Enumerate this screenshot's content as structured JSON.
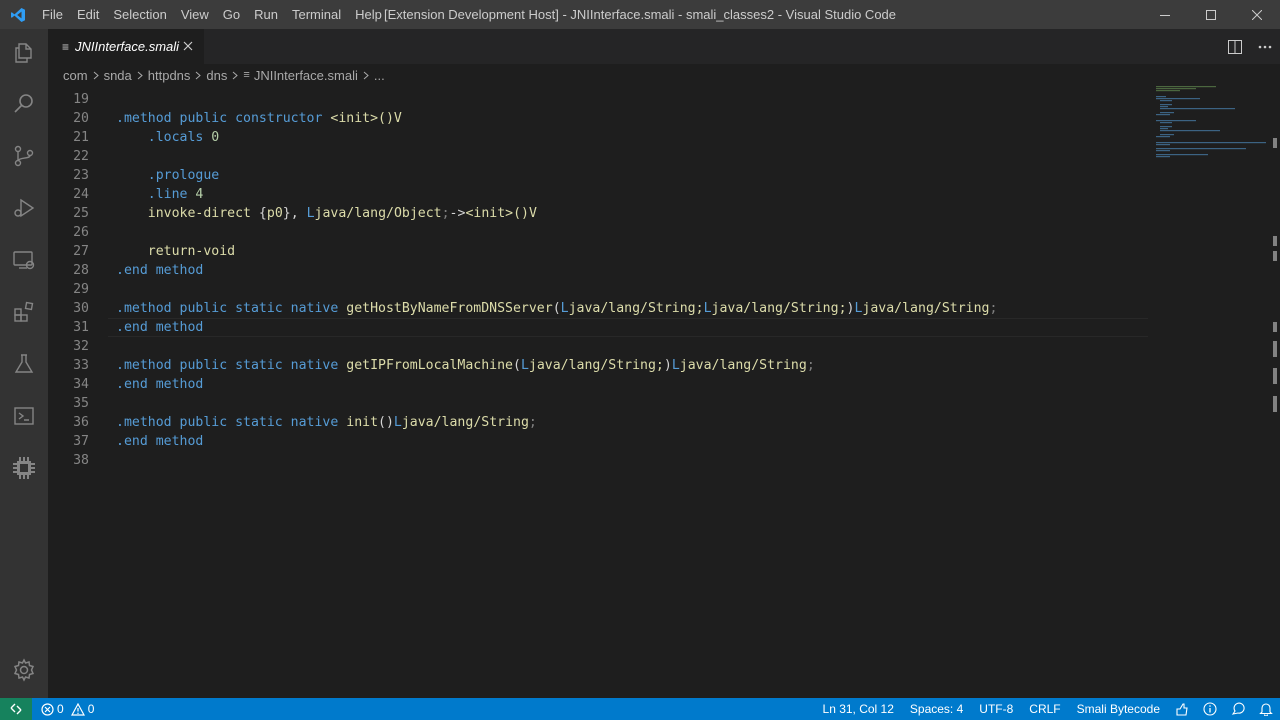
{
  "window": {
    "title": "[Extension Development Host] - JNIInterface.smali - smali_classes2 - Visual Studio Code",
    "menu": [
      "File",
      "Edit",
      "Selection",
      "View",
      "Go",
      "Run",
      "Terminal",
      "Help"
    ]
  },
  "activity_bar": {
    "items": [
      "explorer-icon",
      "search-icon",
      "source-control-icon",
      "run-debug-icon",
      "remote-explorer-icon",
      "extensions-icon",
      "testing-icon",
      "terminal-icon",
      "chip-icon"
    ],
    "bottom": "settings-gear-icon"
  },
  "tab": {
    "label": "JNIInterface.smali",
    "icon_glyph": "≡"
  },
  "breadcrumb": {
    "items": [
      "com",
      "snda",
      "httpdns",
      "dns",
      "JNIInterface.smali",
      "..."
    ]
  },
  "editor": {
    "current_line": 31,
    "lines": [
      {
        "n": "19",
        "tokens": []
      },
      {
        "n": "20",
        "tokens": [
          {
            "t": ".method",
            "c": "kw"
          },
          {
            "t": " public constructor ",
            "c": "pub"
          },
          {
            "t": "<init>",
            "c": "fn"
          },
          {
            "t": "()V",
            "c": "fn"
          }
        ]
      },
      {
        "n": "21",
        "tokens": [
          {
            "t": "    .locals ",
            "c": "kw"
          },
          {
            "t": "0",
            "c": "num"
          }
        ]
      },
      {
        "n": "22",
        "tokens": []
      },
      {
        "n": "23",
        "tokens": [
          {
            "t": "    .prologue",
            "c": "kw"
          }
        ]
      },
      {
        "n": "24",
        "tokens": [
          {
            "t": "    .line ",
            "c": "kw"
          },
          {
            "t": "4",
            "c": "num"
          }
        ]
      },
      {
        "n": "25",
        "tokens": [
          {
            "t": "    invoke-direct ",
            "c": "fn"
          },
          {
            "t": "{",
            "c": "punc"
          },
          {
            "t": "p0",
            "c": "fn"
          },
          {
            "t": "}, ",
            "c": "punc"
          },
          {
            "t": "L",
            "c": "kw"
          },
          {
            "t": "java/lang/Object",
            "c": "fn"
          },
          {
            "t": ";",
            "c": "dim"
          },
          {
            "t": "->",
            "c": "punc"
          },
          {
            "t": "<init>",
            "c": "fn"
          },
          {
            "t": "()V",
            "c": "fn"
          }
        ]
      },
      {
        "n": "26",
        "tokens": []
      },
      {
        "n": "27",
        "tokens": [
          {
            "t": "    return-void",
            "c": "fn"
          }
        ]
      },
      {
        "n": "28",
        "tokens": [
          {
            "t": ".end ",
            "c": "kw"
          },
          {
            "t": "method",
            "c": "kw"
          }
        ]
      },
      {
        "n": "29",
        "tokens": []
      },
      {
        "n": "30",
        "tokens": [
          {
            "t": ".method",
            "c": "kw"
          },
          {
            "t": " public static native ",
            "c": "pub"
          },
          {
            "t": "getHostByNameFromDNSServer",
            "c": "fn"
          },
          {
            "t": "(",
            "c": "punc"
          },
          {
            "t": "L",
            "c": "kw"
          },
          {
            "t": "java/lang/String;",
            "c": "fn"
          },
          {
            "t": "L",
            "c": "kw"
          },
          {
            "t": "java/lang/String;",
            "c": "fn"
          },
          {
            "t": ")",
            "c": "punc"
          },
          {
            "t": "L",
            "c": "kw"
          },
          {
            "t": "java/lang/String",
            "c": "fn"
          },
          {
            "t": ";",
            "c": "dim"
          }
        ]
      },
      {
        "n": "31",
        "tokens": [
          {
            "t": ".end ",
            "c": "kw"
          },
          {
            "t": "method",
            "c": "kw"
          }
        ]
      },
      {
        "n": "32",
        "tokens": []
      },
      {
        "n": "33",
        "tokens": [
          {
            "t": ".method",
            "c": "kw"
          },
          {
            "t": " public static native ",
            "c": "pub"
          },
          {
            "t": "getIPFromLocalMachine",
            "c": "fn"
          },
          {
            "t": "(",
            "c": "punc"
          },
          {
            "t": "L",
            "c": "kw"
          },
          {
            "t": "java/lang/String;",
            "c": "fn"
          },
          {
            "t": ")",
            "c": "punc"
          },
          {
            "t": "L",
            "c": "kw"
          },
          {
            "t": "java/lang/String",
            "c": "fn"
          },
          {
            "t": ";",
            "c": "dim"
          }
        ]
      },
      {
        "n": "34",
        "tokens": [
          {
            "t": ".end ",
            "c": "kw"
          },
          {
            "t": "method",
            "c": "kw"
          }
        ]
      },
      {
        "n": "35",
        "tokens": []
      },
      {
        "n": "36",
        "tokens": [
          {
            "t": ".method",
            "c": "kw"
          },
          {
            "t": " public static native ",
            "c": "pub"
          },
          {
            "t": "init",
            "c": "fn"
          },
          {
            "t": "()",
            "c": "punc"
          },
          {
            "t": "L",
            "c": "kw"
          },
          {
            "t": "java/lang/String",
            "c": "fn"
          },
          {
            "t": ";",
            "c": "dim"
          }
        ]
      },
      {
        "n": "37",
        "tokens": [
          {
            "t": ".end ",
            "c": "kw"
          },
          {
            "t": "method",
            "c": "kw"
          }
        ]
      },
      {
        "n": "38",
        "tokens": []
      }
    ]
  },
  "status_bar": {
    "errors": "0",
    "warnings": "0",
    "position": "Ln 31, Col 12",
    "spaces": "Spaces: 4",
    "encoding": "UTF-8",
    "eol": "CRLF",
    "language": "Smali Bytecode"
  },
  "colors": {
    "status_bar": "#007acc",
    "remote": "#16825d",
    "keyword": "#569cd6",
    "identifier": "#dcdcaa",
    "number": "#b5cea8"
  }
}
